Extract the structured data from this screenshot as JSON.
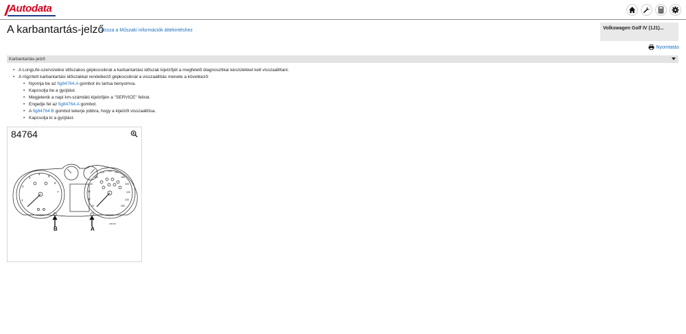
{
  "header": {
    "logo_text": "Autodata",
    "icons": [
      "home-icon",
      "wrench-icon",
      "calculator-icon",
      "gear-icon"
    ]
  },
  "page": {
    "title": "A karbantartás-jelző",
    "back_link": "Vissza a Műszaki információk áttekintéshez"
  },
  "vehicle": {
    "name": "Volkswagen Golf IV (1J1)..."
  },
  "print": {
    "label": "Nyomtatás"
  },
  "section": {
    "title": "Karbantartás-jelző"
  },
  "content": {
    "intro_1": "A LongLife-szervizelési időszakos gépkocsiknál a karbantartási időszak kijelzőjét a megfelelő diagnosztikai készülékkel kell visszaállítani.",
    "intro_2": "A rögzített karbantartási időszakkal rendelkező gépkocsiknál a visszaállítás menete a következő:",
    "step_1_a": "Nyomja be az ",
    "step_1_link": "fig84764.A",
    "step_1_b": " gombot és tartsa benyomva.",
    "step_2": "Kapcsolja be a gyújtást.",
    "step_3": "Megjelenik a napi km-számláló kijelzőjén a \"SERVICE\" felirat.",
    "step_4_a": "Engedje fel az ",
    "step_4_link": "fig84764.A",
    "step_4_b": " gombot.",
    "step_5_a": "A ",
    "step_5_link": "fig84764.B",
    "step_5_b": " gombot tekerje jobbra, hogy a kijelzőt visszaállítsa.",
    "step_6": "Kapcsolja ki a gyújtást."
  },
  "figure": {
    "number": "84764",
    "label_a": "A",
    "label_b": "B",
    "code": "4084764",
    "tach_numbers": [
      "1",
      "2",
      "3",
      "4",
      "5",
      "6",
      "7"
    ],
    "speedo_numbers": [
      "20",
      "40",
      "60",
      "80",
      "100",
      "120",
      "140",
      "160",
      "180",
      "200",
      "220",
      "240",
      "260"
    ]
  }
}
